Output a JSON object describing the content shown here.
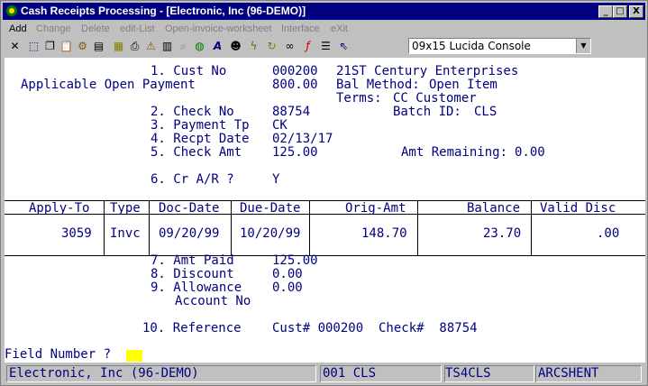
{
  "window": {
    "title": "Cash Receipts Processing - [Electronic, Inc (96-DEMO)]",
    "controls": [
      "_",
      "□",
      "X"
    ]
  },
  "menu": [
    {
      "label": "Add",
      "enabled": true
    },
    {
      "label": "Change",
      "enabled": false
    },
    {
      "label": "Delete",
      "enabled": false
    },
    {
      "label": "edit-List",
      "enabled": false
    },
    {
      "label": "Open-invoice-worksheet",
      "enabled": false
    },
    {
      "label": "Interface",
      "enabled": false
    },
    {
      "label": "eXit",
      "enabled": false
    }
  ],
  "toolbar": {
    "icons": [
      "close-x-icon",
      "select-icon",
      "copy-icon",
      "paste-icon",
      "gear-icon",
      "print-icon",
      "notepad-icon",
      "printer-setup-icon",
      "warning-icon",
      "calculator-icon",
      "search-icon",
      "globe-icon",
      "font-icon",
      "user-icon",
      "lightning-icon",
      "refresh-icon",
      "link-icon",
      "function-icon",
      "list-icon",
      "help-cursor-icon"
    ],
    "font_select": "09x15 Lucida Console"
  },
  "form": {
    "f1_label": "1. Cust No",
    "cust_no": "000200",
    "cust_name": "21ST Century Enterprises",
    "applicable_label": "Applicable Open Payment",
    "applicable_value": "800.00",
    "bal_method_label": "Bal Method:",
    "bal_method_value": "Open Item",
    "terms_label": "Terms:",
    "terms_value": "CC Customer",
    "f2_label": "2. Check No",
    "check_no": "88754",
    "batch_label": "Batch ID:",
    "batch_value": "CLS",
    "f3_label": "3. Payment Tp",
    "payment_tp": "CK",
    "f4_label": "4. Recpt Date",
    "recpt_date": "02/13/17",
    "f5_label": "5. Check Amt",
    "check_amt": "125.00",
    "amt_remaining_label": "Amt Remaining:",
    "amt_remaining": "0.00",
    "f6_label": "6. Cr A/R ?",
    "cr_ar": "Y"
  },
  "table": {
    "headers": [
      "Apply-To",
      "Type",
      "Doc-Date",
      "Due-Date",
      "Orig-Amt",
      "Balance",
      "Valid Disc"
    ],
    "row": [
      "3059",
      "Invc",
      "09/20/99",
      "10/20/99",
      "148.70",
      "23.70",
      ".00"
    ]
  },
  "detail": {
    "f7_label": "7. Amt Paid",
    "amt_paid": "125.00",
    "f8_label": "8. Discount",
    "discount": "0.00",
    "f9_label": "9. Allowance",
    "allowance": "0.00",
    "account_label": "Account No",
    "f10_label": "10. Reference",
    "reference": "Cust# 000200  Check#  88754"
  },
  "prompt": "Field Number ?",
  "statusbar": [
    "Electronic, Inc (96-DEMO)",
    "001 CLS",
    "TS4CLS",
    "ARCSHENT"
  ]
}
